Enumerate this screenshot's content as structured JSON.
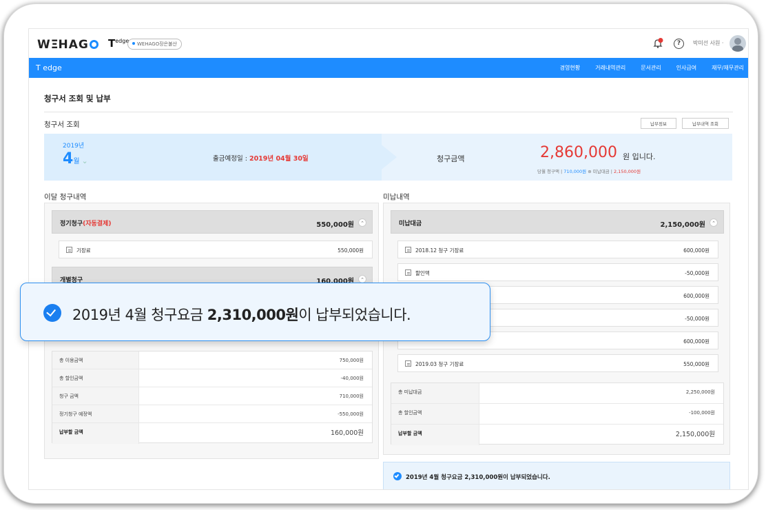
{
  "app": {
    "logo_text": "WEHAGO",
    "product": "T",
    "product_sup": "edge",
    "company": "WEHAGO장은불산",
    "user_name": "박미선 사원 ·"
  },
  "nav": {
    "title": "T edge",
    "items": [
      "경영현황",
      "거래내역관리",
      "문서관리",
      "인사급여",
      "재무/재무관리"
    ]
  },
  "page": {
    "title": "청구서 조회 및 납부",
    "section_title": "청구서 조회",
    "buttons": [
      "납부정보",
      "납부내역 조회"
    ]
  },
  "summary": {
    "year": "2019년",
    "month": "4",
    "month_unit": "월",
    "due_label": "출금예정일 : ",
    "due_date": "2019년 04월 30일",
    "bill_label": "청구금액",
    "bill_amount": "2,860,000",
    "bill_suffix": "원 입니다.",
    "detail_prefix": "당월 청구액 | ",
    "detail_current": "710,000원",
    "detail_mid": " ⊕ 미납대금 | ",
    "detail_unpaid": "2,150,000원"
  },
  "left_panel": {
    "title": "이달 청구내역",
    "group1": {
      "label": "정기청구",
      "label_red": "(자동결제)",
      "value": "550,000원"
    },
    "group1_items": [
      {
        "name": "기장료",
        "amount": "550,000원"
      }
    ],
    "group2": {
      "label": "개별청구",
      "value": "160,000원"
    },
    "summary_rows": [
      {
        "label": "총 이용금액",
        "value": "750,000원"
      },
      {
        "label": "총 할인금액",
        "value": "-40,000원"
      },
      {
        "label": "청구 금액",
        "value": "710,000원"
      },
      {
        "label": "정기청구 예정액",
        "value": "-550,000원"
      },
      {
        "label": "납부할 금액",
        "value": "160,000원"
      }
    ]
  },
  "right_panel": {
    "title": "미납내역",
    "group": {
      "label": "미납대금",
      "value": "2,150,000원"
    },
    "items": [
      {
        "name": "2018.12 청구 기장료",
        "amount": "600,000원"
      },
      {
        "name": "할인액",
        "amount": "-50,000원"
      },
      {
        "name": "",
        "amount": "600,000원"
      },
      {
        "name": "",
        "amount": "-50,000원"
      },
      {
        "name": "",
        "amount": "600,000원"
      },
      {
        "name": "2019.03 청구 기장료",
        "amount": "550,000원"
      }
    ],
    "summary_rows": [
      {
        "label": "총 미납대금",
        "value": "2,250,000원"
      },
      {
        "label": "총 할인금액",
        "value": "-100,000원"
      },
      {
        "label": "납부할 금액",
        "value": "2,150,000원"
      }
    ]
  },
  "notice": {
    "small_text": "2019년 4월 청구요금 2,310,000원이 납부되었습니다.",
    "toast_prefix": "2019년 4월 청구요금 ",
    "toast_amount": "2,310,000원",
    "toast_suffix": "이 납부되었습니다."
  },
  "colors": {
    "accent": "#1e8cff",
    "alert": "#e53935"
  }
}
